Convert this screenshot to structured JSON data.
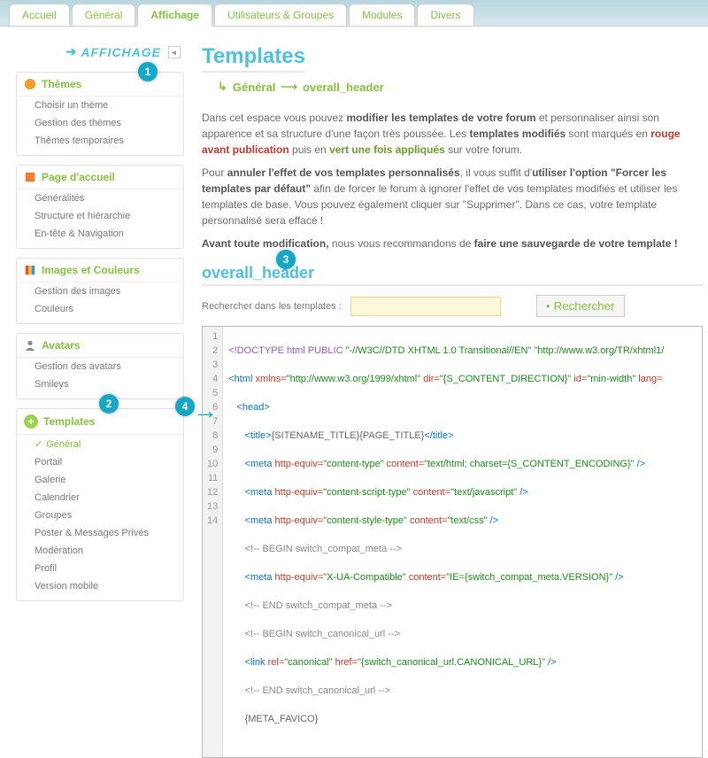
{
  "tabs": {
    "accueil": "Accueil",
    "general": "Général",
    "affichage": "Affichage",
    "users": "Utilisateurs & Groupes",
    "modules": "Modules",
    "divers": "Divers"
  },
  "breadcrumb_label": "AFFICHAGE",
  "sidebar": {
    "themes": {
      "title": "Thèmes",
      "items": [
        "Choisir un thème",
        "Gestion des thèmes",
        "Thèmes temporaires"
      ]
    },
    "page": {
      "title": "Page d'accueil",
      "items": [
        "Généralités",
        "Structure et hiérarchie",
        "En-tête & Navigation"
      ]
    },
    "images": {
      "title": "Images et Couleurs",
      "items": [
        "Gestion des images",
        "Couleurs"
      ]
    },
    "avatars": {
      "title": "Avatars",
      "items": [
        "Gestion des avatars",
        "Smileys"
      ]
    },
    "templates": {
      "title": "Templates",
      "items": [
        "Général",
        "Portail",
        "Galerie",
        "Calendrier",
        "Groupes",
        "Poster & Messages Privés",
        "Modération",
        "Profil",
        "Version mobile"
      ]
    }
  },
  "main": {
    "title": "Templates",
    "path1": "Général",
    "path2": "overall_header",
    "intro1a": "Dans cet espace vous pouvez ",
    "intro1b": "modifier les templates de votre forum",
    "intro1c": " et personnaliser ainsi son apparence et sa structure d'une façon très poussée. Les ",
    "intro1d": "templates modifiés",
    "intro1e": " sont marqués en ",
    "intro1f": "rouge avant publication",
    "intro1g": " puis en ",
    "intro1h": "vert une fois appliqués",
    "intro1i": " sur votre forum.",
    "intro2a": "Pour ",
    "intro2b": "annuler l'effet de vos templates personnalisés",
    "intro2c": ", il vous suffit d'",
    "intro2d": "utiliser l'option \"Forcer les templates par défaut\"",
    "intro2e": " afin de forcer le forum à ignorer l'effet de vos templates modifiés et utiliser les templates de base. Vous pouvez également cliquer sur \"Supprimer\". Dans ce cas, votre template personnalisé sera effacé !",
    "intro3a": "Avant toute modification,",
    "intro3b": " nous vous recommandons de ",
    "intro3c": "faire une sauvegarde de votre template !",
    "h2": "overall_header",
    "search_label": "Rechercher dans les templates :",
    "search_btn": "Rechercher"
  },
  "callouts": {
    "c1": "1",
    "c2": "2",
    "c3": "3",
    "c4": "4"
  },
  "code": {
    "l1a": "<!DOCTYPE html PUBLIC ",
    "l1b": "\"-//W3C//DTD XHTML 1.0 Transitional//EN\" \"http://www.w3.org/TR/xhtml1/",
    "l2a": "<html ",
    "l2b": "xmlns=",
    "l2c": "\"http://www.w3.org/1999/xhtml\"",
    "l2d": " dir=",
    "l2e": "\"{S_CONTENT_DIRECTION}\"",
    "l2f": " id=",
    "l2g": "\"min-width\"",
    "l2h": " lang=",
    "l3": "<head>",
    "l4a": "<title>",
    "l4b": "{SITENAME_TITLE}{PAGE_TITLE}",
    "l4c": "</title>",
    "l5a": "<meta ",
    "l5b": "http-equiv=",
    "l5c": "\"content-type\"",
    "l5d": " content=",
    "l5e": "\"text/html; charset={S_CONTENT_ENCODING}\"",
    "l5f": " />",
    "l6a": "<meta ",
    "l6b": "http-equiv=",
    "l6c": "\"content-script-type\"",
    "l6d": " content=",
    "l6e": "\"text/javascript\"",
    "l6f": " />",
    "l7a": "<meta ",
    "l7b": "http-equiv=",
    "l7c": "\"content-style-type\"",
    "l7d": " content=",
    "l7e": "\"text/css\"",
    "l7f": " />",
    "l8": "<!-- BEGIN switch_compat_meta -->",
    "l9a": "<meta ",
    "l9b": "http-equiv=",
    "l9c": "\"X-UA-Compatible\"",
    "l9d": " content=",
    "l9e": "\"IE={switch_compat_meta.VERSION}\"",
    "l9f": " />",
    "l10": "<!-- END switch_compat_meta -->",
    "l11": "<!-- BEGIN switch_canonical_url -->",
    "l12a": "<link ",
    "l12b": "rel=",
    "l12c": "\"canonical\"",
    "l12d": " href=",
    "l12e": "\"{switch_canonical_url.CANONICAL_URL}\"",
    "l12f": " />",
    "l13": "<!-- END switch_canonical_url -->",
    "l14": "{META_FAVICO}"
  }
}
